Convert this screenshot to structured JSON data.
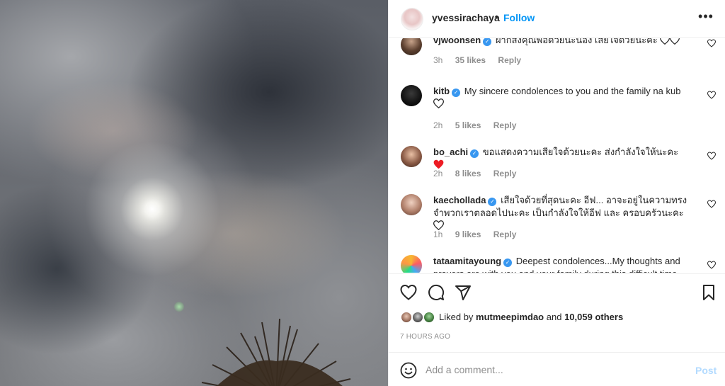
{
  "post": {
    "username": "yvessirachaya",
    "separator": "•",
    "follow_label": "Follow",
    "more_label": "•••"
  },
  "comments": [
    {
      "username": "vjwoonsen",
      "verified": true,
      "text": "ฝากส่งคุณพ่อด้วยนะน้อง เสียใจด้วยนะคะ",
      "time": "3h",
      "likes": "35 likes",
      "reply": "Reply"
    },
    {
      "username": "kitb",
      "verified": true,
      "text": "My sincere condolences to you and the family na kub",
      "time": "2h",
      "likes": "5 likes",
      "reply": "Reply"
    },
    {
      "username": "bo_achi",
      "verified": true,
      "text": "ขอแสดงความเสียใจด้วยนะคะ ส่งกำลังใจให้นะคะ",
      "time": "2h",
      "likes": "8 likes",
      "reply": "Reply"
    },
    {
      "username": "kaechollada",
      "verified": true,
      "text": "เสียใจด้วยที่สุดนะคะ อีฟ... อาจะอยู่ในความทรงจำพวกเราตลอดไปนะคะ เป็นกำลังใจให้อีฟ และ ครอบครัวนะคะ",
      "time": "1h",
      "likes": "9 likes",
      "reply": "Reply"
    },
    {
      "username": "tataamitayoung",
      "verified": true,
      "text": "Deepest condolences...My thoughts and prayers are with you and your family during this difficult time",
      "time": "",
      "likes": "",
      "reply": ""
    }
  ],
  "likes_line": {
    "prefix": "Liked by",
    "user": "mutmeepimdao",
    "and": "and",
    "others": "10,059 others"
  },
  "timestamp": "7 HOURS AGO",
  "add_comment": {
    "placeholder": "Add a comment...",
    "post_label": "Post"
  },
  "icons": {
    "actions": [
      "heart-icon",
      "comment-icon",
      "share-icon",
      "bookmark-icon"
    ],
    "comment_like": "heart-outline-icon",
    "emoji": "emoji-icon",
    "more": "more-icon",
    "verified": "verified-badge-icon"
  },
  "colors": {
    "accent": "#0095f6",
    "verified": "#3897f0",
    "muted": "#8e8e8e",
    "text": "#262626",
    "post_disabled": "#b3dbff",
    "red_heart": "#ed1c24"
  }
}
